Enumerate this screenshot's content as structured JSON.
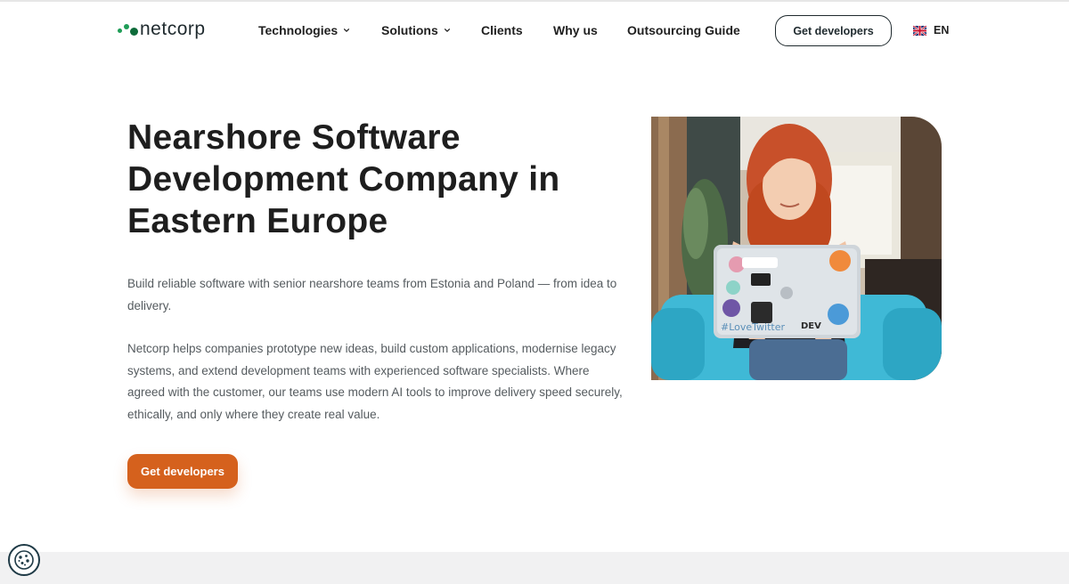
{
  "brand": {
    "name": "netcorp",
    "logo_icon": "three-dots-logo-icon",
    "color_primary": "#1f9d57",
    "color_dark": "#0e6b3a"
  },
  "nav": {
    "items": [
      {
        "label": "Technologies",
        "has_dropdown": true
      },
      {
        "label": "Solutions",
        "has_dropdown": true
      },
      {
        "label": "Clients",
        "has_dropdown": false
      },
      {
        "label": "Why us",
        "has_dropdown": false
      },
      {
        "label": "Outsourcing Guide",
        "has_dropdown": false
      }
    ],
    "cta_label": "Get developers",
    "language": {
      "code": "EN",
      "flag_icon": "uk-flag-icon"
    }
  },
  "hero": {
    "title": "Nearshore Software Development Company in Eastern Europe",
    "paragraph_1": "Build reliable software with senior nearshore teams from Estonia and Poland — from idea to delivery.",
    "paragraph_2": "Netcorp helps companies prototype new ideas, build custom applications, modernise legacy systems, and extend development teams with experienced software specialists. Where agreed with the customer, our teams use modern AI tools to improve delivery speed securely, ethically, and only where they create real value.",
    "cta_label": "Get developers",
    "cta_color": "#d5611d",
    "image": {
      "laptop_sticker_text": "#LoveTwitter",
      "laptop_sticker_dev": "DEV"
    }
  },
  "cookie": {
    "icon": "cookie-icon"
  }
}
